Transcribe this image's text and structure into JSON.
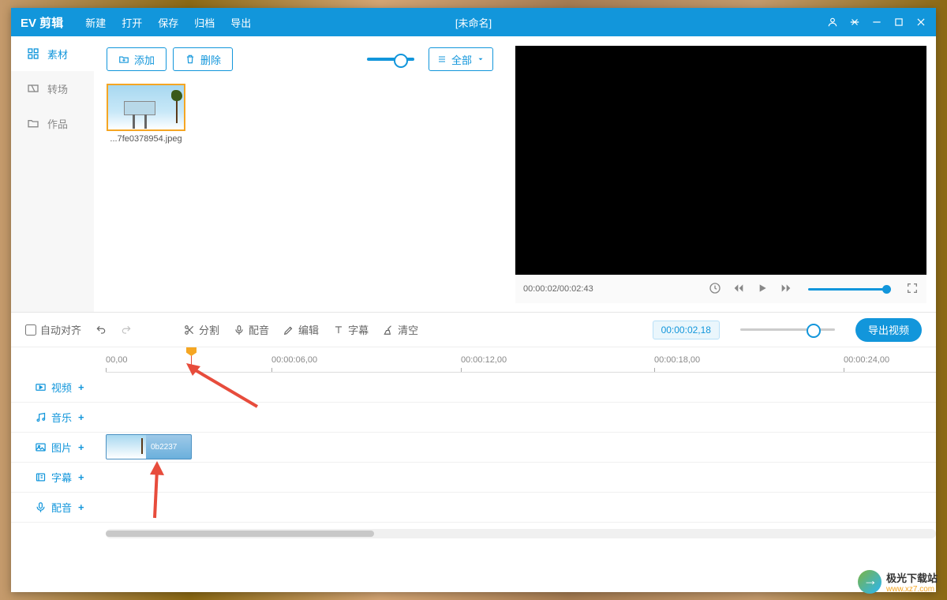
{
  "app": {
    "name": "EV 剪辑",
    "title": "[未命名]"
  },
  "menu": {
    "new": "新建",
    "open": "打开",
    "save": "保存",
    "archive": "归档",
    "export": "导出"
  },
  "sidebar": {
    "material": "素材",
    "transition": "转场",
    "works": "作品"
  },
  "media_toolbar": {
    "add": "添加",
    "delete": "删除",
    "filter": "全部"
  },
  "media_items": [
    {
      "filename": "...7fe0378954.jpeg"
    }
  ],
  "player": {
    "current": "00:00:02",
    "total": "00:02:43"
  },
  "timeline_toolbar": {
    "auto_align": "自动对齐",
    "split": "分割",
    "dub": "配音",
    "edit": "编辑",
    "subtitle": "字幕",
    "clear": "清空",
    "timecode": "00:00:02,18",
    "export_video": "导出视频"
  },
  "ruler": {
    "ticks": [
      "00,00",
      "00:00:06,00",
      "00:00:12,00",
      "00:00:18,00",
      "00:00:24,00"
    ]
  },
  "tracks": {
    "video": "视频",
    "music": "音乐",
    "image": "图片",
    "subtitle": "字幕",
    "dub": "配音"
  },
  "clips": {
    "image_clip": "0b2237"
  },
  "watermark": {
    "name": "极光下载站",
    "url": "www.xz7.com"
  }
}
